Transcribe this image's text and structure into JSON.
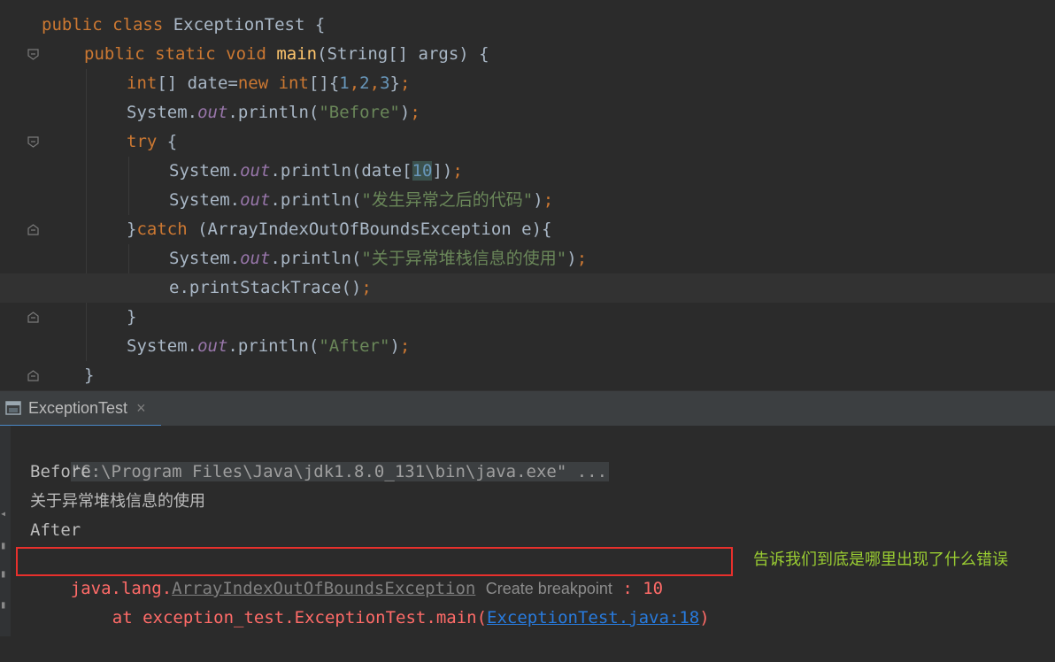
{
  "editor": {
    "lines": [
      {
        "t": [
          [
            "kw",
            "public "
          ],
          [
            "kw",
            "class "
          ],
          [
            "",
            "ExceptionTest {"
          ]
        ]
      },
      {
        "t": [
          [
            "kw",
            "public "
          ],
          [
            "kw",
            "static "
          ],
          [
            "kw",
            "void "
          ],
          [
            "fn",
            "main"
          ],
          [
            "",
            "(String[] args) {"
          ]
        ]
      },
      {
        "t": [
          [
            "kw",
            "int"
          ],
          [
            "",
            "[] date="
          ],
          [
            "kw",
            "new "
          ],
          [
            "kw",
            "int"
          ],
          [
            "",
            "[]{"
          ],
          [
            "num",
            "1"
          ],
          [
            "kw",
            ","
          ],
          [
            "num",
            "2"
          ],
          [
            "kw",
            ","
          ],
          [
            "num",
            "3"
          ],
          [
            "",
            "}"
          ],
          [
            "kw",
            ";"
          ]
        ]
      },
      {
        "t": [
          [
            "",
            "System."
          ],
          [
            "fld",
            "out"
          ],
          [
            "",
            ".println("
          ],
          [
            "str",
            "\"Before\""
          ],
          [
            "",
            ")"
          ],
          [
            "kw",
            ";"
          ]
        ]
      },
      {
        "t": [
          [
            "kw",
            "try "
          ],
          [
            "",
            "{"
          ]
        ]
      },
      {
        "t": [
          [
            "",
            "System."
          ],
          [
            "fld",
            "out"
          ],
          [
            "",
            ".println(date["
          ],
          [
            "hl-num",
            "10"
          ],
          [
            "",
            "])"
          ],
          [
            "kw",
            ";"
          ]
        ]
      },
      {
        "t": [
          [
            "",
            "System."
          ],
          [
            "fld",
            "out"
          ],
          [
            "",
            ".println("
          ],
          [
            "str",
            "\"发生异常之后的代码\""
          ],
          [
            "",
            ")"
          ],
          [
            "kw",
            ";"
          ]
        ]
      },
      {
        "t": [
          [
            "",
            "}"
          ],
          [
            "kw",
            "catch "
          ],
          [
            "",
            "(ArrayIndexOutOfBoundsException e){"
          ]
        ]
      },
      {
        "t": [
          [
            "",
            "System."
          ],
          [
            "fld",
            "out"
          ],
          [
            "",
            ".println("
          ],
          [
            "str",
            "\"关于异常堆栈信息的使用\""
          ],
          [
            "",
            ")"
          ],
          [
            "kw",
            ";"
          ]
        ]
      },
      {
        "t": [
          [
            "",
            "e.printStackTrace()"
          ],
          [
            "kw",
            ";"
          ]
        ]
      },
      {
        "t": [
          [
            "",
            "}"
          ]
        ]
      },
      {
        "t": [
          [
            "",
            "System."
          ],
          [
            "fld",
            "out"
          ],
          [
            "",
            ".println("
          ],
          [
            "str",
            "\"After\""
          ],
          [
            "",
            ")"
          ],
          [
            "kw",
            ";"
          ]
        ]
      },
      {
        "t": [
          [
            "",
            "}"
          ]
        ]
      }
    ]
  },
  "run_panel": {
    "tab_label": "ExceptionTest",
    "tab_icon": "run-console-icon",
    "close_glyph": "×"
  },
  "console": {
    "command": "\"C:\\Program Files\\Java\\jdk1.8.0_131\\bin\\java.exe\" ...",
    "out_before": "Before",
    "out_catch": "关于异常堆栈信息的使用",
    "out_after": "After",
    "exception_pkg": "java.lang.",
    "exception_class": "ArrayIndexOutOfBoundsException",
    "breakpoint_hint": "Create breakpoint",
    "exception_msg": " : 10",
    "stack_prefix": "at exception_test.ExceptionTest.main(",
    "stack_link": "ExceptionTest.java:18",
    "stack_suffix": ")"
  },
  "annotation": {
    "text": "告诉我们到底是哪里出现了什么错误",
    "color": "#9acd32",
    "box_color": "#e8302c"
  }
}
